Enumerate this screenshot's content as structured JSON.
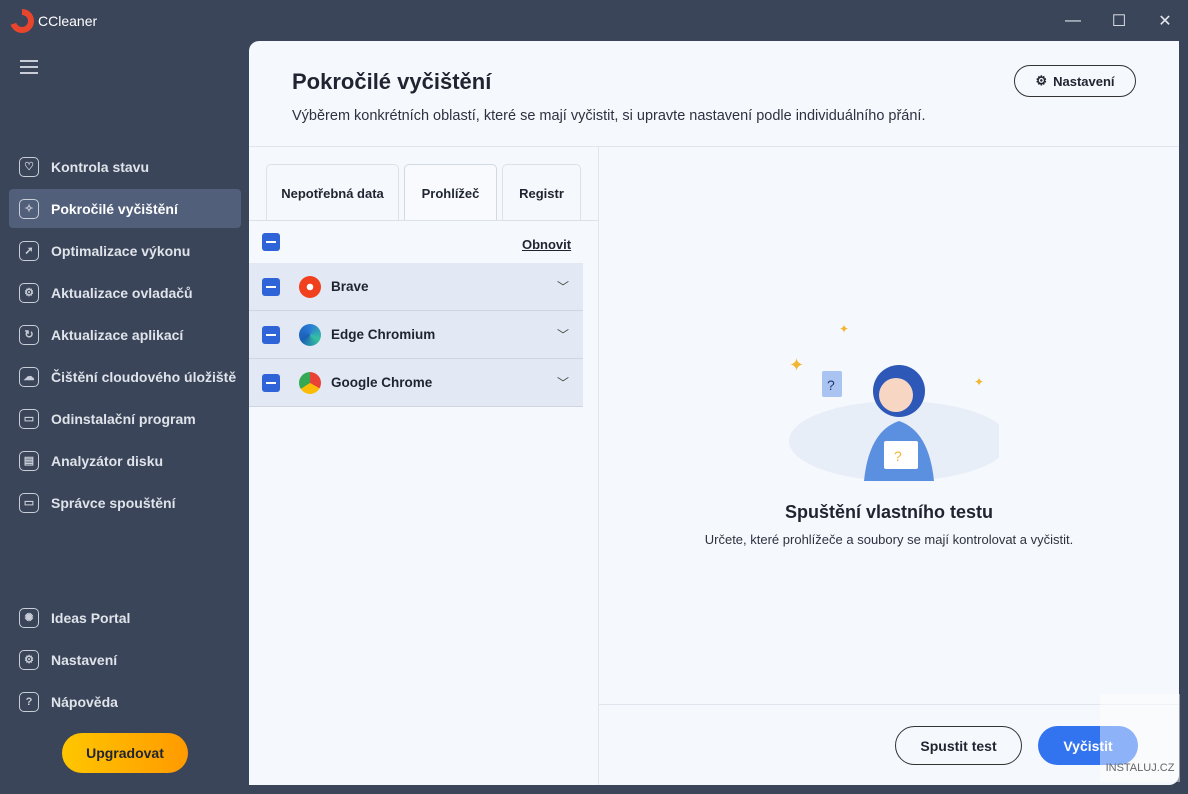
{
  "app": {
    "title": "CCleaner"
  },
  "sidebar": {
    "items": [
      {
        "label": "Kontrola stavu",
        "icon": "heart-icon"
      },
      {
        "label": "Pokročilé vyčištění",
        "icon": "broom-icon",
        "active": true
      },
      {
        "label": "Optimalizace výkonu",
        "icon": "rocket-icon"
      },
      {
        "label": "Aktualizace ovladačů",
        "icon": "gear-chip-icon"
      },
      {
        "label": "Aktualizace aplikací",
        "icon": "refresh-icon"
      },
      {
        "label": "Čištění cloudového úložiště",
        "icon": "cloud-gear-icon"
      },
      {
        "label": "Odinstalační program",
        "icon": "uninstall-icon"
      },
      {
        "label": "Analyzátor disku",
        "icon": "document-icon"
      },
      {
        "label": "Správce spouštění",
        "icon": "monitor-icon"
      }
    ],
    "bottom": [
      {
        "label": "Ideas Portal",
        "icon": "bulb-icon"
      },
      {
        "label": "Nastavení",
        "icon": "gear-icon"
      },
      {
        "label": "Nápověda",
        "icon": "help-icon"
      }
    ],
    "upgrade": "Upgradovat"
  },
  "main": {
    "title": "Pokročilé vyčištění",
    "subtitle": "Výběrem konkrétních oblastí, které se mají vyčistit, si upravte nastavení podle individuálního přání.",
    "settings": "Nastavení",
    "tabs": [
      "Nepotřebná data",
      "Prohlížeč",
      "Registr"
    ],
    "reset": "Obnovit",
    "browsers": [
      "Brave",
      "Edge Chromium",
      "Google Chrome"
    ],
    "empty_title": "Spuštění vlastního testu",
    "empty_text": "Určete, které prohlížeče a soubory se mají kontrolovat a vyčistit.",
    "run_test": "Spustit test",
    "clean": "Vyčistit"
  },
  "watermark": "INSTALUJ.CZ",
  "colors": {
    "accent": "#2e64d8",
    "primary_button": "#3273f0",
    "upgrade": "#ffb000",
    "sidebar": "#3b4559"
  }
}
